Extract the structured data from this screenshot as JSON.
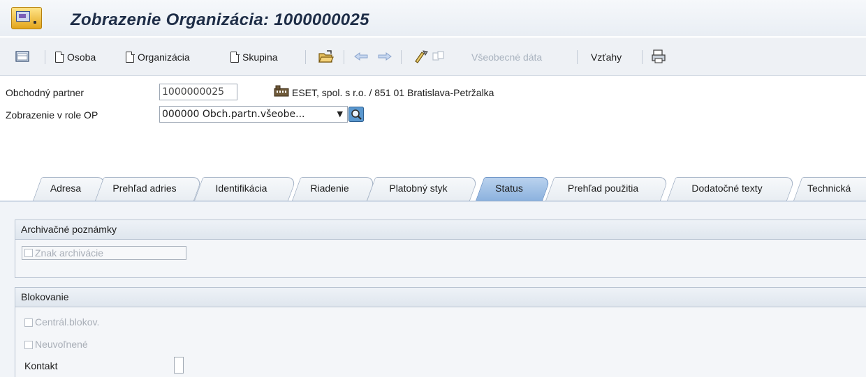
{
  "title": "Zobrazenie Organizácia: 1000000025",
  "toolbar": {
    "osoba": "Osoba",
    "organizacia": "Organizácia",
    "skupina": "Skupina",
    "vseobecne_data": "Všeobecné dáta",
    "vztahy": "Vzťahy"
  },
  "header": {
    "partner_label": "Obchodný partner",
    "partner_value": "1000000025",
    "partner_description": "ESET, spol. s r.o. / 851 01 Bratislava-Petržalka",
    "role_label": "Zobrazenie v role OP",
    "role_value": "000000 Obch.partn.všeobe..."
  },
  "tabs": [
    "Adresa",
    "Prehľad adries",
    "Identifikácia",
    "Riadenie",
    "Platobný styk",
    "Status",
    "Prehľad použitia",
    "Dodatočné texty",
    "Technická"
  ],
  "active_tab": "Status",
  "sections": {
    "archive": {
      "title": "Archivačné poznámky",
      "archive_flag_label": "Znak archivácie"
    },
    "blocking": {
      "title": "Blokovanie",
      "central_block_label": "Centrál.blokov.",
      "unreleased_label": "Neuvoľnené",
      "contact_label": "Kontakt"
    }
  },
  "colors": {
    "active_tab": "#8cb2de",
    "title_text": "#1e2d47",
    "toolbar_bg": "#eef1f5"
  }
}
